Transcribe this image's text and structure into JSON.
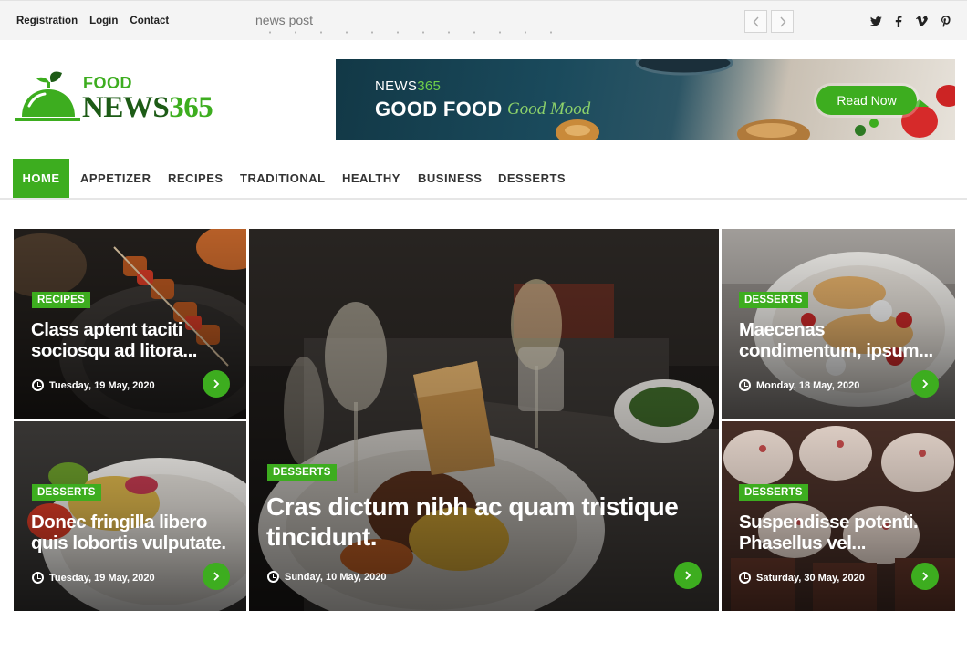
{
  "topbar": {
    "links": [
      "Registration",
      "Login",
      "Contact"
    ],
    "ticker_label": "news post",
    "social_icons": [
      "twitter-icon",
      "facebook-icon",
      "vimeo-icon",
      "pinterest-icon"
    ]
  },
  "logo": {
    "food": "FOOD",
    "news": "NEWS",
    "num": "365"
  },
  "banner": {
    "news": "NEWS",
    "num": "365",
    "headline": "GOOD FOOD",
    "script": "Good Mood",
    "button": "Read Now"
  },
  "nav": {
    "items": [
      "HOME",
      "APPETIZER",
      "RECIPES",
      "TRADITIONAL",
      "HEALTHY",
      "BUSINESS",
      "DESSERTS"
    ],
    "active": "HOME"
  },
  "posts": [
    {
      "category": "RECIPES",
      "title_line1": "Class aptent taciti",
      "title_line2": "sociosqu ad litora...",
      "date": "Tuesday, 19 May, 2020"
    },
    {
      "category": "DESSERTS",
      "title_line1": "Cras dictum nibh ac quam tristique",
      "title_line2": "tincidunt.",
      "date": "Sunday, 10 May, 2020"
    },
    {
      "category": "DESSERTS",
      "title_line1": "Maecenas",
      "title_line2": "condimentum, ipsum...",
      "date": "Monday, 18 May, 2020"
    },
    {
      "category": "DESSERTS",
      "title_line1": "Donec fringilla libero",
      "title_line2": "quis lobortis vulputate.",
      "date": "Tuesday, 19 May, 2020"
    },
    {
      "category": "DESSERTS",
      "title_line1": "Suspendisse potenti.",
      "title_line2": "Phasellus vel...",
      "date": "Saturday, 30 May, 2020"
    }
  ],
  "colors": {
    "accent": "#3dad1f",
    "dark_green": "#1d5b16",
    "topbar_bg": "#f4f4f4"
  }
}
